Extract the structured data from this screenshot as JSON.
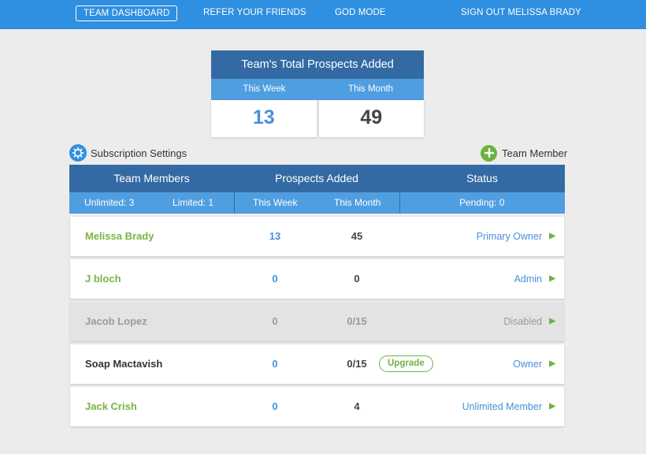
{
  "nav": {
    "team_dashboard": "TEAM DASHBOARD",
    "refer_friends": "REFER YOUR FRIENDS",
    "god_mode": "GOD MODE",
    "sign_out": "SIGN OUT MELISSA BRADY"
  },
  "totals": {
    "title": "Team's Total Prospects Added",
    "week_label": "This Week",
    "month_label": "This Month",
    "week_value": "13",
    "month_value": "49"
  },
  "actions": {
    "subscription_settings": "Subscription Settings",
    "add_member": "Team Member"
  },
  "table": {
    "headers": {
      "team_members": "Team Members",
      "prospects_added": "Prospects Added",
      "status": "Status"
    },
    "subheaders": {
      "unlimited": "Unlimited: 3",
      "limited": "Limited: 1",
      "this_week": "This Week",
      "this_month": "This Month",
      "pending": "Pending: 0"
    },
    "rows": [
      {
        "name": "Melissa Brady",
        "week": "13",
        "month": "45",
        "status": "Primary Owner"
      },
      {
        "name": "J bloch",
        "week": "0",
        "month": "0",
        "status": "Admin"
      },
      {
        "name": "Jacob Lopez",
        "week": "0",
        "month": "0/15",
        "status": "Disabled"
      },
      {
        "name": "Soap Mactavish",
        "week": "0",
        "month": "0/15",
        "status": "Owner",
        "upgrade": "Upgrade"
      },
      {
        "name": "Jack Crish",
        "week": "0",
        "month": "4",
        "status": "Unlimited Member"
      }
    ]
  },
  "colors": {
    "nav_blue": "#2f8fe0",
    "header_dark": "#336aa4",
    "header_light": "#4f9ee0",
    "green": "#7cb342",
    "value_blue": "#4a90d9"
  },
  "icons": {
    "settings": "gear-icon",
    "add": "plus-circle-icon",
    "row_action": "play-arrow-icon"
  }
}
